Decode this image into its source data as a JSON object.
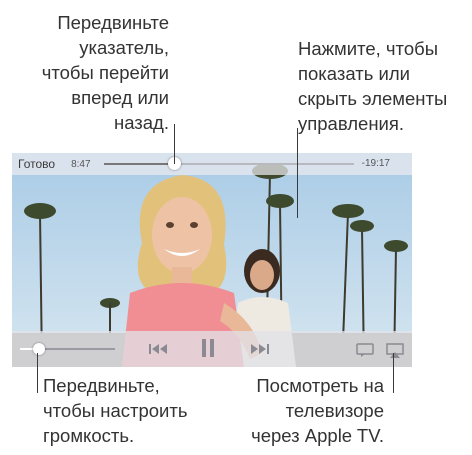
{
  "callouts": {
    "scrub": "Передвиньте\nуказатель,\nчтобы перейти\nвперед или\nназад.",
    "tap": "Нажмите, чтобы\nпоказать или\nскрыть элементы\nуправления.",
    "volume": "Передвиньте,\nчтобы настроить\nгромкость.",
    "tv": "Посмотреть на\nтелевизоре\nчерез Apple TV."
  },
  "player": {
    "done_label": "Готово",
    "elapsed": "8:47",
    "remaining": "-19:17",
    "playback_progress": 0.28,
    "volume_level": 0.2,
    "controls": {
      "rewind": "rewind-icon",
      "pause": "pause-icon",
      "forward": "fast-forward-icon",
      "subtitles": "subtitles-icon",
      "airplay": "airplay-icon"
    }
  },
  "colors": {
    "bar_background": "#ebebf0",
    "control_gray": "#8a8a92",
    "sky": "#b5d3ea",
    "annotation_text": "#333333"
  }
}
